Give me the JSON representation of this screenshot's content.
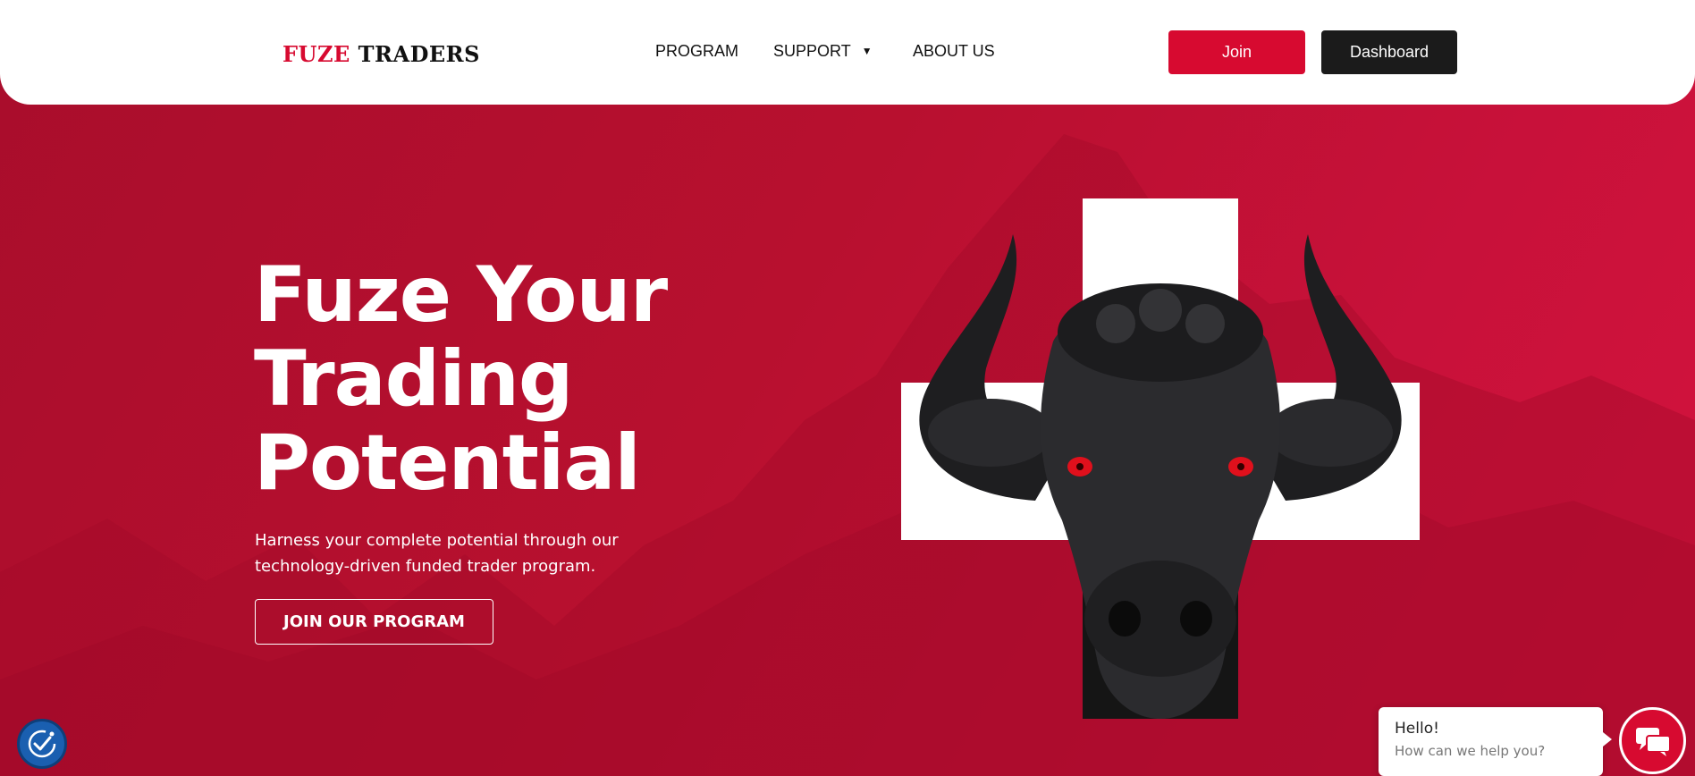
{
  "brand": {
    "name_part1": "FUZE",
    "name_part2": "TRADERS",
    "accent": "#d70a30"
  },
  "nav": {
    "items": [
      {
        "label": "PROGRAM"
      },
      {
        "label": "SUPPORT",
        "has_dropdown": true
      },
      {
        "label": "ABOUT US"
      }
    ]
  },
  "header_buttons": {
    "join": "Join",
    "dashboard": "Dashboard"
  },
  "hero": {
    "headline_lines": [
      "Fuze Your",
      "Trading",
      "Potential"
    ],
    "subtext_lines": [
      "Harness your complete potential through our",
      "technology-driven funded trader program."
    ],
    "cta": "JOIN OUR PROGRAM",
    "background_color": "#b8102f"
  },
  "chat": {
    "greeting": "Hello!",
    "prompt": "How can we help you?"
  },
  "icons": {
    "accessibility": "accessibility-icon",
    "chat": "chat-icon",
    "dropdown": "chevron-down-icon"
  }
}
